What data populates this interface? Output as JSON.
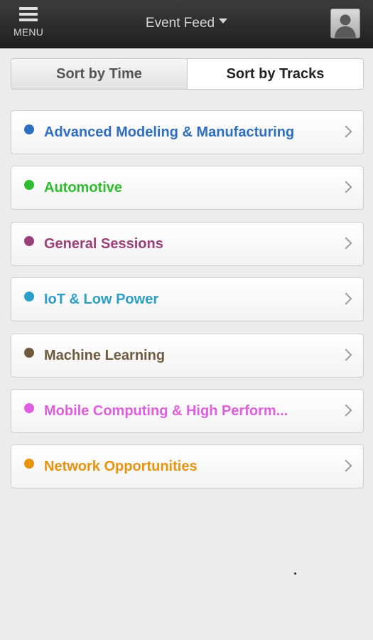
{
  "topbar": {
    "menu_label": "MENU",
    "title": "Event Feed",
    "menu_icon": "hamburger-icon",
    "dropdown_icon": "caret-down-icon",
    "avatar_icon": "user-avatar-icon"
  },
  "tabs": {
    "time_label": "Sort by Time",
    "tracks_label": "Sort by Tracks",
    "selected": "Sort by Tracks"
  },
  "tracks": [
    {
      "label": "Advanced Modeling & Manufacturing",
      "color": "#2f6fc0"
    },
    {
      "label": "Automotive",
      "color": "#2ebd2e"
    },
    {
      "label": "General Sessions",
      "color": "#9b3f78"
    },
    {
      "label": "IoT & Low Power",
      "color": "#2d9ec7"
    },
    {
      "label": "Machine Learning",
      "color": "#6f5a3d"
    },
    {
      "label": "Mobile Computing & High Perform...",
      "color": "#e05fe0"
    },
    {
      "label": "Network Opportunities",
      "color": "#e8940f"
    }
  ],
  "colors": {
    "topbar_bg": "#2b2b2b",
    "page_bg": "#ececec",
    "chevron": "#9a9a9a"
  }
}
